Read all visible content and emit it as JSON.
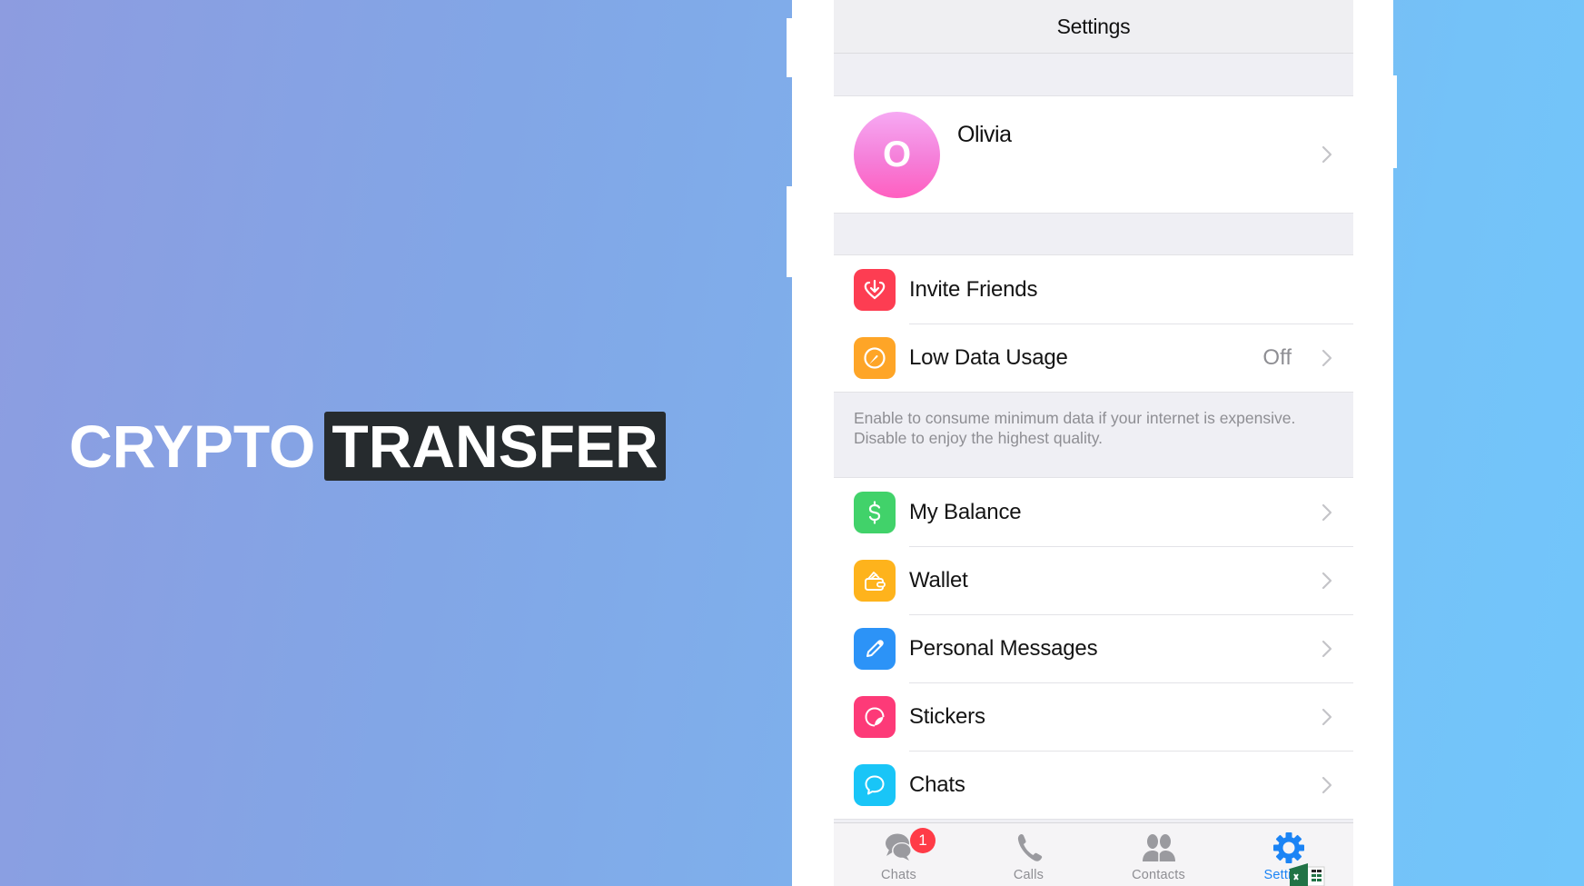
{
  "overlay": {
    "title_part1": "CRYPTO",
    "title_part2": "TRANSFER"
  },
  "navbar": {
    "title": "Settings"
  },
  "profile": {
    "initial": "O",
    "name": "Olivia"
  },
  "group1": {
    "items": [
      {
        "label": "Invite Friends",
        "icon": "heart-download-icon",
        "color": "#fd3d52"
      },
      {
        "label": "Low Data Usage",
        "value": "Off",
        "icon": "gauge-icon",
        "color": "#fea527"
      }
    ],
    "footer": "Enable to consume minimum data if your internet is expensive. Disable to enjoy the highest quality."
  },
  "group2": {
    "items": [
      {
        "label": "My Balance",
        "icon": "dollar-icon",
        "color": "#41d26a"
      },
      {
        "label": "Wallet",
        "icon": "wallet-icon",
        "color": "#feb31c"
      },
      {
        "label": "Personal Messages",
        "icon": "pencil-icon",
        "color": "#2c93f7"
      },
      {
        "label": "Stickers",
        "icon": "sticker-icon",
        "color": "#fd3a78"
      },
      {
        "label": "Chats",
        "icon": "chat-bubble-icon",
        "color": "#19c5f7"
      }
    ]
  },
  "tabbar": {
    "tabs": [
      {
        "label": "Chats",
        "badge": "1",
        "active": false
      },
      {
        "label": "Calls",
        "active": false
      },
      {
        "label": "Contacts",
        "active": false
      },
      {
        "label": "Settings",
        "active": true
      }
    ],
    "active_color": "#1b84f5",
    "inactive_color": "#8e8e93"
  }
}
